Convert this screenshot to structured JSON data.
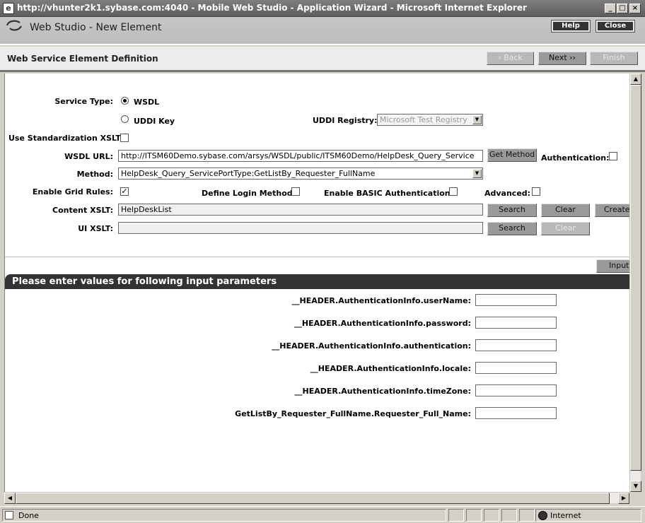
{
  "window": {
    "title": "http://vhunter2k1.sybase.com:4040 - Mobile Web Studio - Application Wizard - Microsoft Internet Explorer",
    "min": "_",
    "max": "□",
    "close": "×"
  },
  "header": {
    "title": "Web Studio - New Element",
    "help": "Help",
    "close": "Close"
  },
  "section": {
    "title": "Web Service Element Definition",
    "back": "‹ Back",
    "next": "Next ››",
    "finish": "Finish"
  },
  "form": {
    "service_type_label": "Service Type:",
    "wsdl_option": "WSDL",
    "uddi_option": "UDDI Key",
    "uddi_registry_label": "UDDI Registry:",
    "uddi_registry_value": "Microsoft Test Registry",
    "use_std_xslt_label": "Use Standardization XSLT:",
    "wsdl_url_label": "WSDL URL:",
    "wsdl_url_value": "http://ITSM60Demo.sybase.com/arsys/WSDL/public/ITSM60Demo/HelpDesk_Query_Service",
    "get_method": "Get Method",
    "authentication_label": "Authentication:",
    "method_label": "Method:",
    "method_value": "HelpDesk_Query_ServicePortType:GetListBy_Requester_FullName",
    "enable_grid_label": "Enable Grid Rules:",
    "define_login_label": "Define Login Method:",
    "enable_basic_label": "Enable BASIC Authentication:",
    "advanced_label": "Advanced:",
    "content_xslt_label": "Content XSLT:",
    "content_xslt_value": "HelpDeskList",
    "ui_xslt_label": "UI XSLT:",
    "ui_xslt_value": "",
    "search": "Search",
    "clear": "Clear",
    "create": "Create",
    "input": "Input",
    "check_mark": "✓"
  },
  "params": {
    "header": "Please enter values for following input parameters",
    "items": [
      {
        "label": "__HEADER.AuthenticationInfo.userName:",
        "value": ""
      },
      {
        "label": "__HEADER.AuthenticationInfo.password:",
        "value": ""
      },
      {
        "label": "__HEADER.AuthenticationInfo.authentication:",
        "value": ""
      },
      {
        "label": "__HEADER.AuthenticationInfo.locale:",
        "value": ""
      },
      {
        "label": "__HEADER.AuthenticationInfo.timeZone:",
        "value": ""
      },
      {
        "label": "GetListBy_Requester_FullName.Requester_Full_Name:",
        "value": ""
      }
    ]
  },
  "status": {
    "text": "Done",
    "zone": "Internet"
  }
}
